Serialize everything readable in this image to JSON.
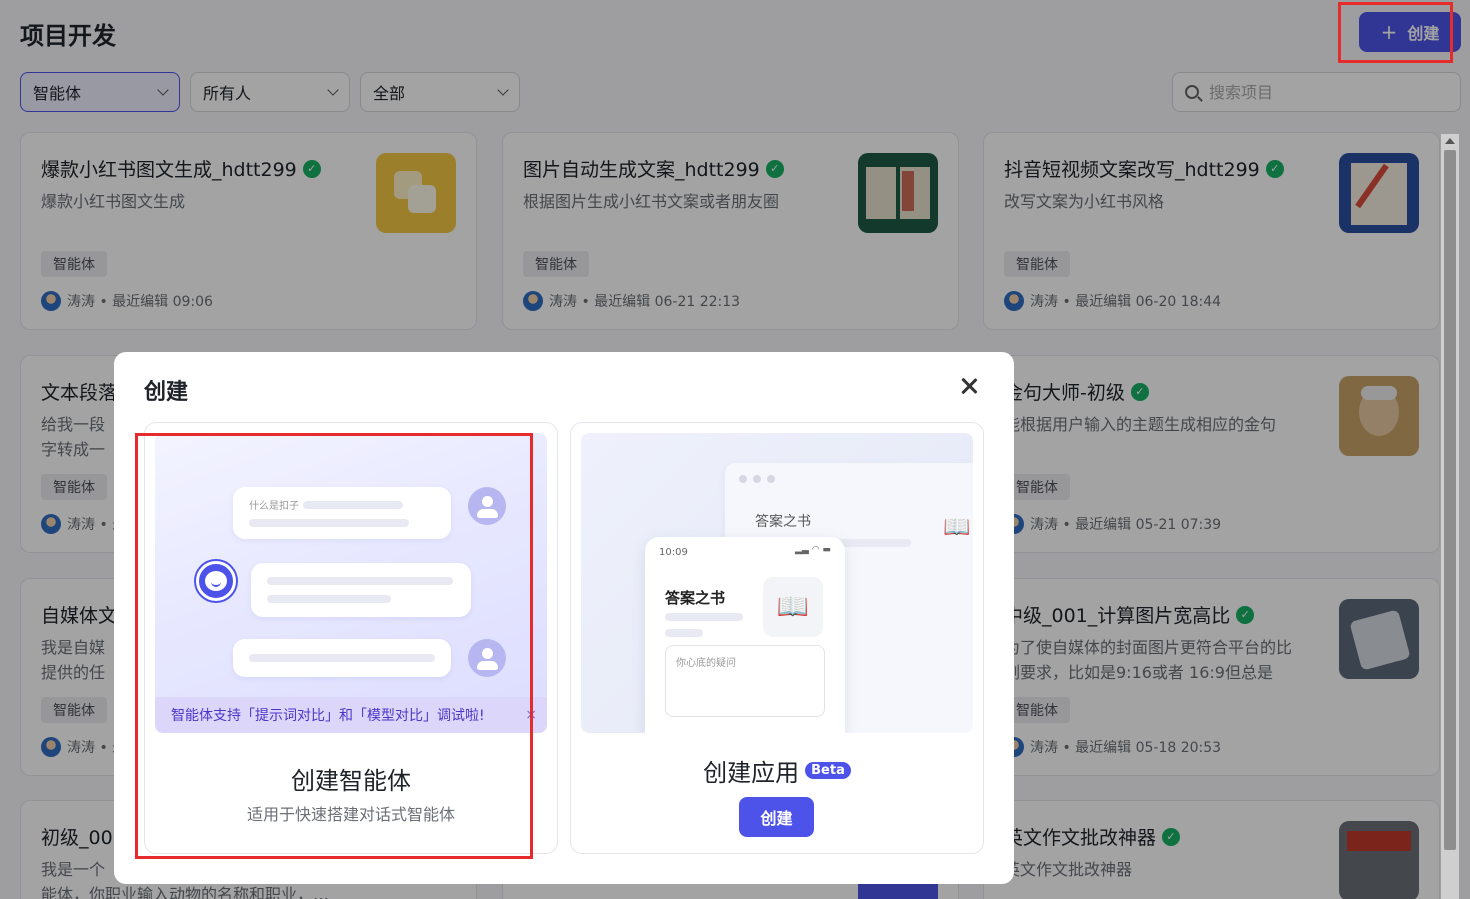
{
  "header": {
    "title": "项目开发",
    "create_label": "创建",
    "create_icon": "plus-icon"
  },
  "filters": [
    {
      "value": "智能体",
      "active": true
    },
    {
      "value": "所有人",
      "active": false
    },
    {
      "value": "全部",
      "active": false
    }
  ],
  "search": {
    "placeholder": "搜索项目"
  },
  "cards": [
    {
      "title": "爆款小红书图文生成_hdtt299",
      "desc": "爆款小红书图文生成",
      "tag": "智能体",
      "meta": "涛涛 • 最近编辑 09:06",
      "verified": true
    },
    {
      "title": "图片自动生成文案_hdtt299",
      "desc": "根据图片生成小红书文案或者朋友圈",
      "tag": "智能体",
      "meta": "涛涛 • 最近编辑 06-21 22:13",
      "verified": true
    },
    {
      "title": "抖音短视频文案改写_hdtt299",
      "desc": "改写文案为小红书风格",
      "tag": "智能体",
      "meta": "涛涛 • 最近编辑 06-20 18:44",
      "verified": true
    },
    {
      "title": "文本段落",
      "desc": "给我一段\n字转成一",
      "tag": "智能体",
      "meta": "涛涛 • 最",
      "verified": false
    },
    {
      "title": "金句大师-初级",
      "desc": "能根据用户输入的主题生成相应的金句",
      "tag": "智能体",
      "meta": "涛涛 • 最近编辑 05-21 07:39",
      "verified": true
    },
    {
      "title": "自媒体文",
      "desc": "我是自媒\n提供的任",
      "tag": "智能体",
      "meta": "涛涛 • 最",
      "verified": false
    },
    {
      "title": "中级_001_计算图片宽高比",
      "desc": "为了使自媒体的封面图片更符合平台的比例要求，比如是9:16或者 16:9但总是要…",
      "tag": "智能体",
      "meta": "涛涛 • 最近编辑 05-18 20:53",
      "verified": true
    },
    {
      "title": "初级_00",
      "desc": "我是一个\n能体，你职业输入动物的名称和职业，…",
      "tag": "智能体",
      "meta": "",
      "verified": false
    },
    {
      "title": "英文作文批改神器",
      "desc": "英文作文批改神器",
      "tag": "",
      "meta": "",
      "verified": true
    }
  ],
  "modal": {
    "title": "创建",
    "close_icon": "close-icon",
    "option_agent": {
      "title": "创建智能体",
      "subtitle": "适用于快速搭建对话式智能体",
      "preview_question": "什么是扣子",
      "tip": "智能体支持「提示词对比」和「模型对比」调试啦!",
      "tip_close": "×"
    },
    "option_app": {
      "title": "创建应用",
      "badge": "Beta",
      "button": "创建",
      "preview_window_title": "答案之书",
      "preview_phone_time": "10:09",
      "preview_phone_title": "答案之书",
      "preview_input_placeholder": "你心底的疑问"
    }
  },
  "colors": {
    "accent": "#4d53e8",
    "verified": "#16b163",
    "highlight": "#e52b2b"
  }
}
